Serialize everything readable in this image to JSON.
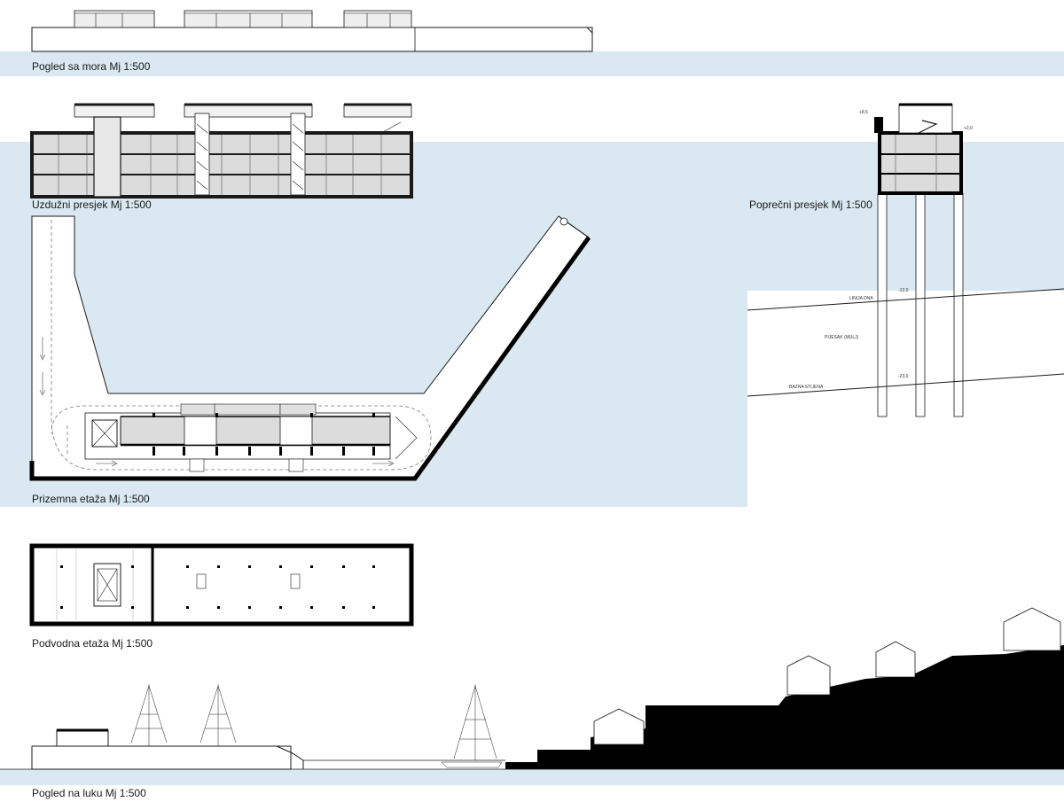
{
  "drawings": {
    "sea_view": {
      "caption": "Pogled sa mora Mj 1:500"
    },
    "longitudinal_section": {
      "caption": "Uzdužni presjek Mj 1:500"
    },
    "cross_section": {
      "caption": "Poprečni presjek Mj 1:500",
      "annotations": {
        "seabed_line": "LINIJA DNA",
        "sand_layer": "PIJESAK (MULJ)",
        "pile_base": "BAZNA STIJENA",
        "level_top": "+8,5",
        "level_deck": "+2,0",
        "level_seabed": "-12,0",
        "level_base": "-23,0"
      }
    },
    "ground_floor": {
      "caption": "Prizemna etaža Mj 1:500"
    },
    "underwater_floor": {
      "caption": "Podvodna etaža Mj 1:500"
    },
    "harbour_view": {
      "caption": "Pogled na luku Mj 1:500"
    }
  },
  "colors": {
    "sea": "#d9e8f1",
    "line": "#1a1a1a",
    "fill_grey": "#dcdcdc",
    "land": "#000000"
  }
}
